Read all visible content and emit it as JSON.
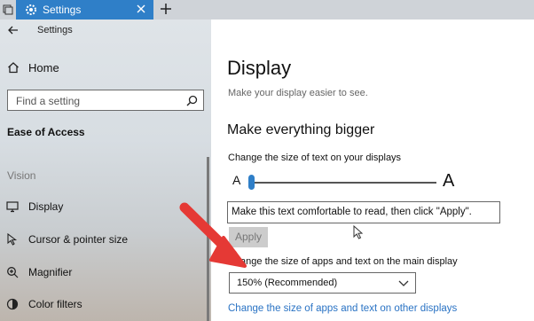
{
  "window": {
    "tab_title": "Settings"
  },
  "sidebar": {
    "title": "Settings",
    "home_label": "Home",
    "search_placeholder": "Find a setting",
    "section_title": "Ease of Access",
    "group_label": "Vision",
    "items": [
      {
        "label": "Display",
        "icon": "monitor-icon"
      },
      {
        "label": "Cursor & pointer size",
        "icon": "cursor-icon"
      },
      {
        "label": "Magnifier",
        "icon": "magnifier-icon"
      },
      {
        "label": "Color filters",
        "icon": "color-filters-icon"
      }
    ]
  },
  "main": {
    "title": "Display",
    "subtitle": "Make your display easier to see.",
    "section_title": "Make everything bigger",
    "text_size_label": "Change the size of text on your displays",
    "slider_small_label": "A",
    "slider_large_label": "A",
    "slider_value": 0,
    "sample_text": "Make this text comfortable to read, then click \"Apply\".",
    "apply_label": "Apply",
    "scale_label": "Change the size of apps and text on the main display",
    "scale_selected": "150% (Recommended)",
    "other_displays_link": "Change the size of apps and text on other displays"
  },
  "colors": {
    "accent": "#2f7fc8",
    "annotation_arrow": "#e53935"
  }
}
